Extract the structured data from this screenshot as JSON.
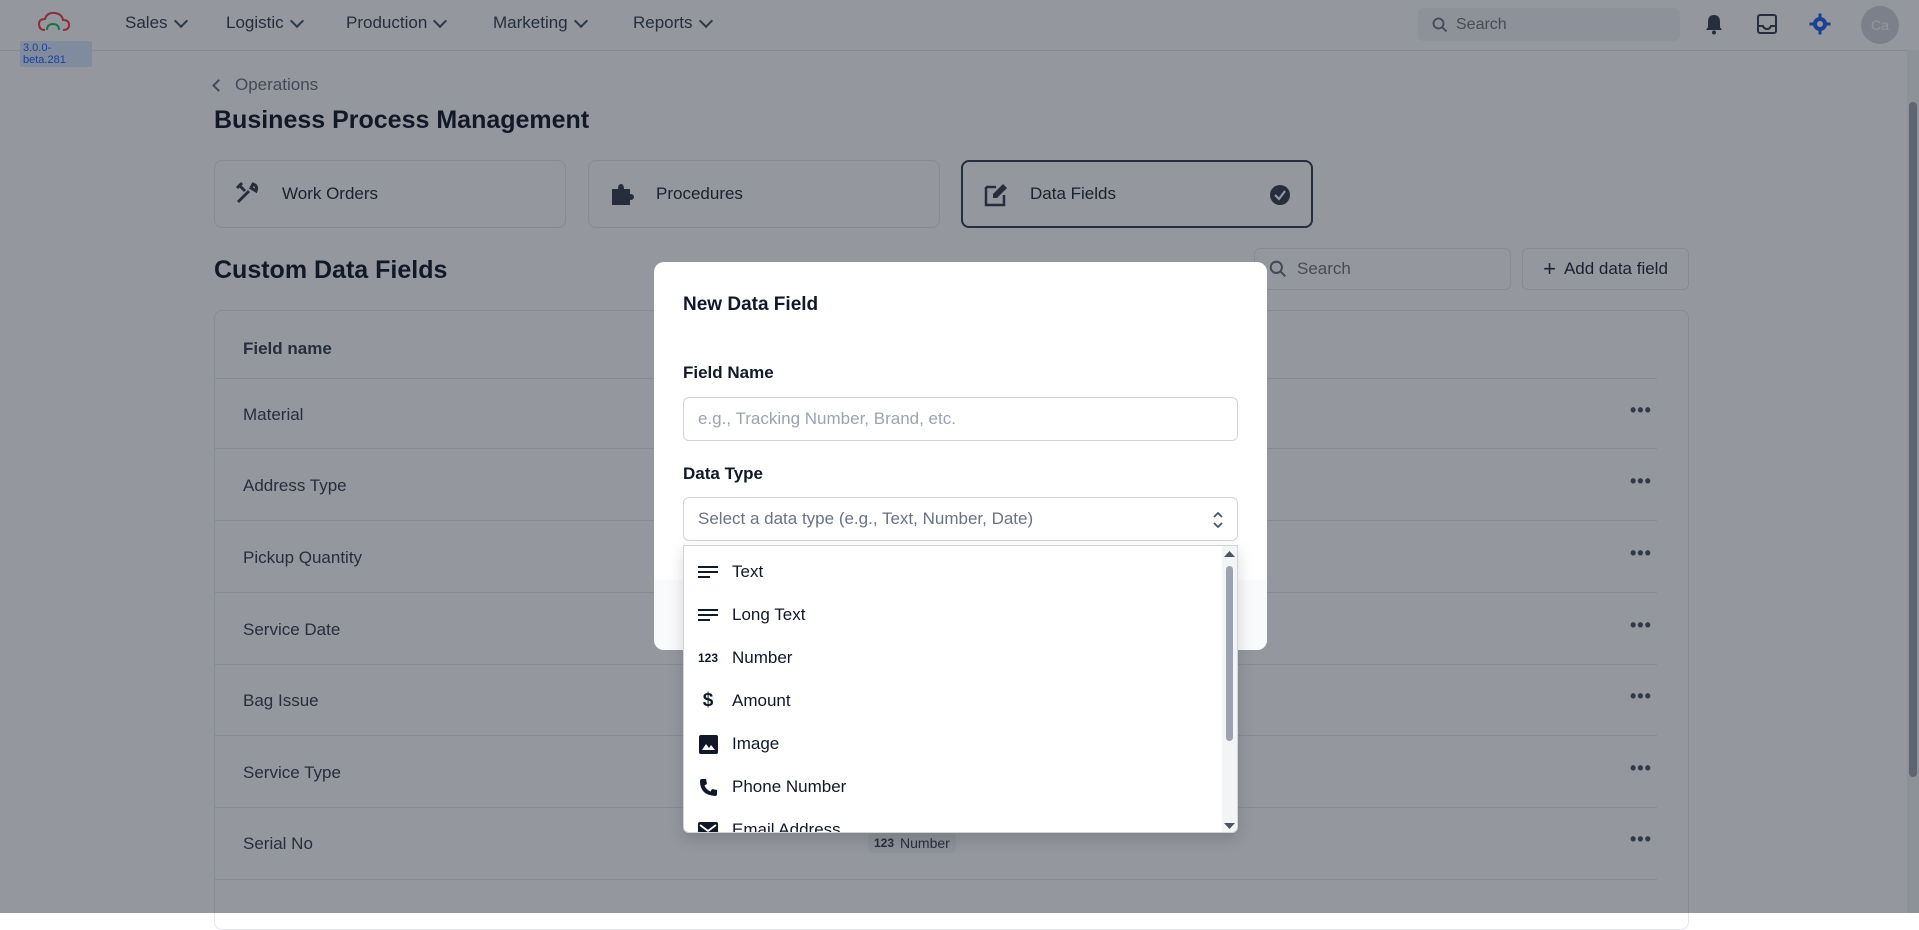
{
  "app": {
    "version": "3.0.0-beta.281"
  },
  "nav": [
    {
      "label": "Sales"
    },
    {
      "label": "Logistic"
    },
    {
      "label": "Production"
    },
    {
      "label": "Marketing"
    },
    {
      "label": "Reports"
    }
  ],
  "top_search": {
    "placeholder": "Search"
  },
  "user": {
    "initials": "Ca"
  },
  "breadcrumb": {
    "label": "Operations"
  },
  "page": {
    "title": "Business Process Management"
  },
  "cards": [
    {
      "label": "Work Orders",
      "icon": "tools-icon"
    },
    {
      "label": "Procedures",
      "icon": "puzzle-icon"
    },
    {
      "label": "Data Fields",
      "icon": "edit-icon",
      "active": true
    }
  ],
  "section": {
    "title": "Custom Data Fields",
    "search_placeholder": "Search",
    "add_label": "Add data field"
  },
  "table": {
    "header": "Field name",
    "rows": [
      {
        "name": "Material"
      },
      {
        "name": "Address Type"
      },
      {
        "name": "Pickup Quantity"
      },
      {
        "name": "Service Date"
      },
      {
        "name": "Bag Issue"
      },
      {
        "name": "Service Type"
      },
      {
        "name": "Serial No",
        "type": "Number"
      }
    ]
  },
  "modal": {
    "title": "New Data Field",
    "field_name_label": "Field Name",
    "field_name_placeholder": "e.g., Tracking Number, Brand, etc.",
    "data_type_label": "Data Type",
    "data_type_placeholder": "Select a data type (e.g., Text, Number, Date)",
    "options": [
      {
        "label": "Text",
        "icon": "text-lines-icon"
      },
      {
        "label": "Long Text",
        "icon": "text-lines-icon"
      },
      {
        "label": "Number",
        "icon": "number-123-icon"
      },
      {
        "label": "Amount",
        "icon": "dollar-icon"
      },
      {
        "label": "Image",
        "icon": "image-icon"
      },
      {
        "label": "Phone Number",
        "icon": "phone-icon"
      },
      {
        "label": "Email Address",
        "icon": "mail-icon"
      }
    ]
  },
  "colors": {
    "accent": "#2563eb"
  }
}
